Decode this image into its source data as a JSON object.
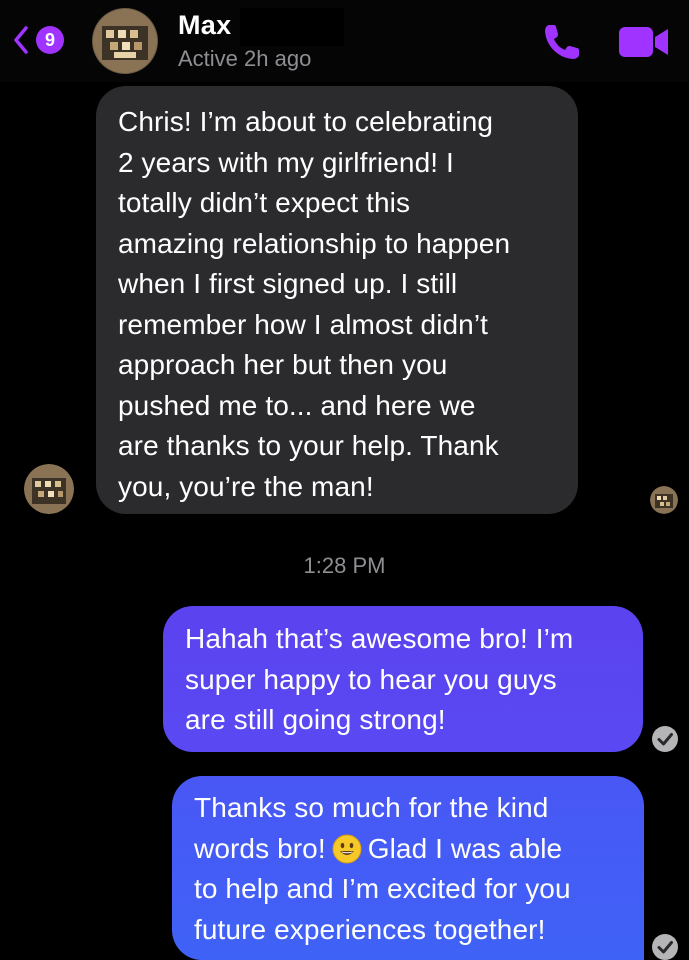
{
  "header": {
    "back_count": "9",
    "contact_name": "Max",
    "status": "Active 2h ago",
    "icons": [
      "back-chevron-icon",
      "phone-icon",
      "video-camera-icon"
    ],
    "accent_color": "#a033ff"
  },
  "messages": {
    "incoming_text": "Chris! I’m about to celebrating\n2 years with my girlfriend! I\ntotally didn’t expect this\namazing relationship to happen\nwhen I first signed up. I still\nremember how I almost didn’t\napproach her but then you\npushed me to... and here we\nare thanks to your help. Thank\nyou, you’re the man!",
    "timestamp": "1:28 PM",
    "outgoing_1_text": "Hahah that’s awesome bro! I’m\nsuper happy to hear you guys\nare still going strong!",
    "outgoing_2_before_emoji": "Thanks so much for the kind\nwords bro!",
    "outgoing_2_emoji": "smiling-face-emoji",
    "outgoing_2_after_emoji": "Glad I was able\nto help and I’m excited for you\nfuture experiences together!",
    "incoming_bubble_color": "#2b2b2d",
    "outgoing_bubble_color": "#5a49f2"
  }
}
